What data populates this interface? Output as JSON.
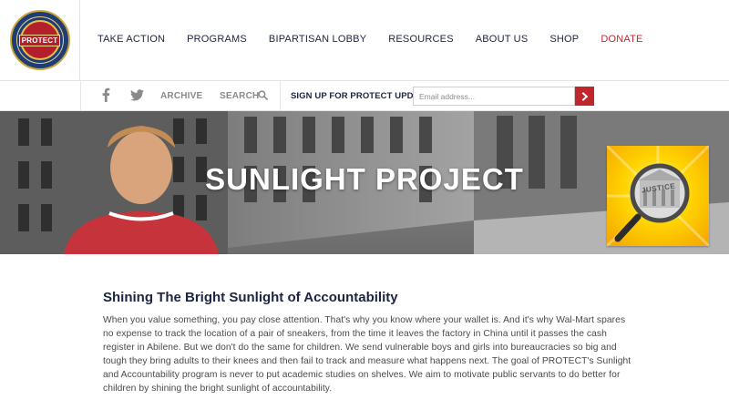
{
  "header": {
    "logo_text": "PROTECT",
    "logo_ring_text": "National Association to Protect Children",
    "nav": [
      {
        "label": "TAKE ACTION"
      },
      {
        "label": "PROGRAMS"
      },
      {
        "label": "BIPARTISAN LOBBY"
      },
      {
        "label": "RESOURCES"
      },
      {
        "label": "ABOUT US"
      },
      {
        "label": "SHOP"
      },
      {
        "label": "DONATE",
        "highlight": true
      }
    ]
  },
  "utility": {
    "facebook_icon": "facebook-icon",
    "twitter_icon": "twitter-icon",
    "archive_label": "ARCHIVE",
    "search_label": "SEARCH",
    "signup_label": "SIGN UP FOR PROTECT UPDATES",
    "email_placeholder": "Email address...",
    "submit_icon": "chevron-right-icon"
  },
  "hero": {
    "title": "SUNLIGHT PROJECT",
    "badge_text": "JUSTICE"
  },
  "main": {
    "heading": "Shining The Bright Sunlight of Accountability",
    "body": "When you value something, you pay close attention. That's why you know where your wallet is. And it's why Wal-Mart spares no expense to track the location of a pair of sneakers, from the time it leaves the factory in China until it passes the cash register in Abilene. But we don't do the same for children. We send vulnerable boys and girls into bureaucracies so big and tough they bring adults to their knees and then fail to track and measure what happens next. The goal of PROTECT's Sunlight and Accountability program is never to put academic studies on shelves. We aim to motivate public servants to do better for children by shining the bright sunlight of accountability."
  },
  "colors": {
    "brand_navy": "#1d2440",
    "accent_red": "#c0272d",
    "badge_yellow": "#ffd400"
  }
}
